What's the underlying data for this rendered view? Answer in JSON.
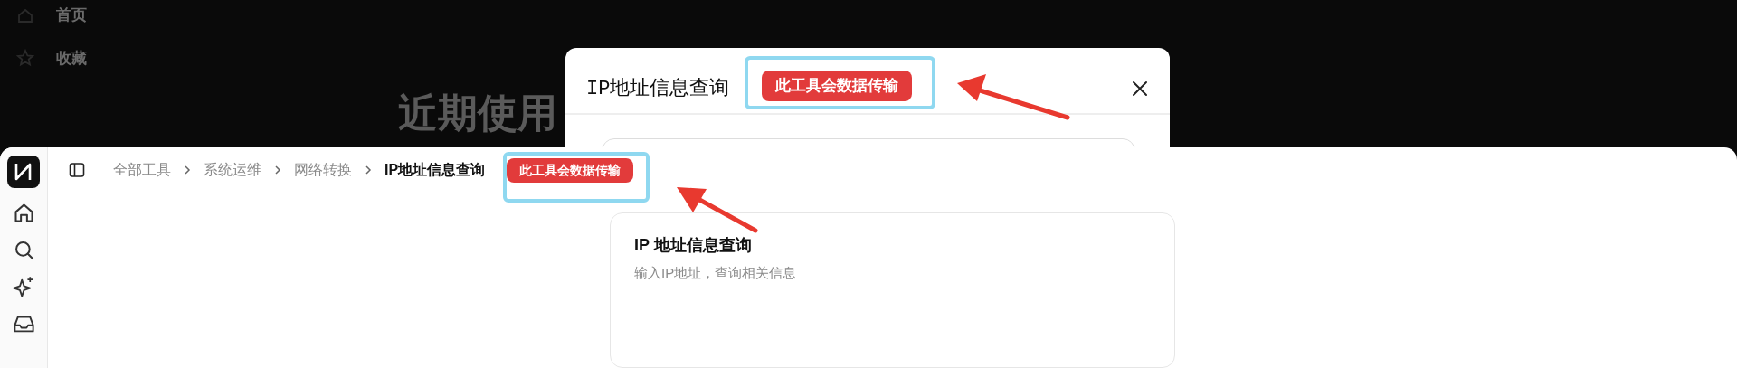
{
  "background_screen": {
    "sidebar_items": [
      {
        "label": "首页",
        "kind": "home"
      },
      {
        "label": "收藏",
        "kind": "star"
      }
    ],
    "heading": "近期使用"
  },
  "modal": {
    "title": "IP地址信息查询",
    "badge": "此工具会数据传输"
  },
  "app": {
    "breadcrumb": [
      {
        "label": "全部工具",
        "current": false
      },
      {
        "label": "系统运维",
        "current": false
      },
      {
        "label": "网络转换",
        "current": false
      },
      {
        "label": "IP地址信息查询",
        "current": true
      }
    ],
    "badge": "此工具会数据传输",
    "card": {
      "title": "IP 地址信息查询",
      "subtitle": "输入IP地址，查询相关信息"
    }
  }
}
